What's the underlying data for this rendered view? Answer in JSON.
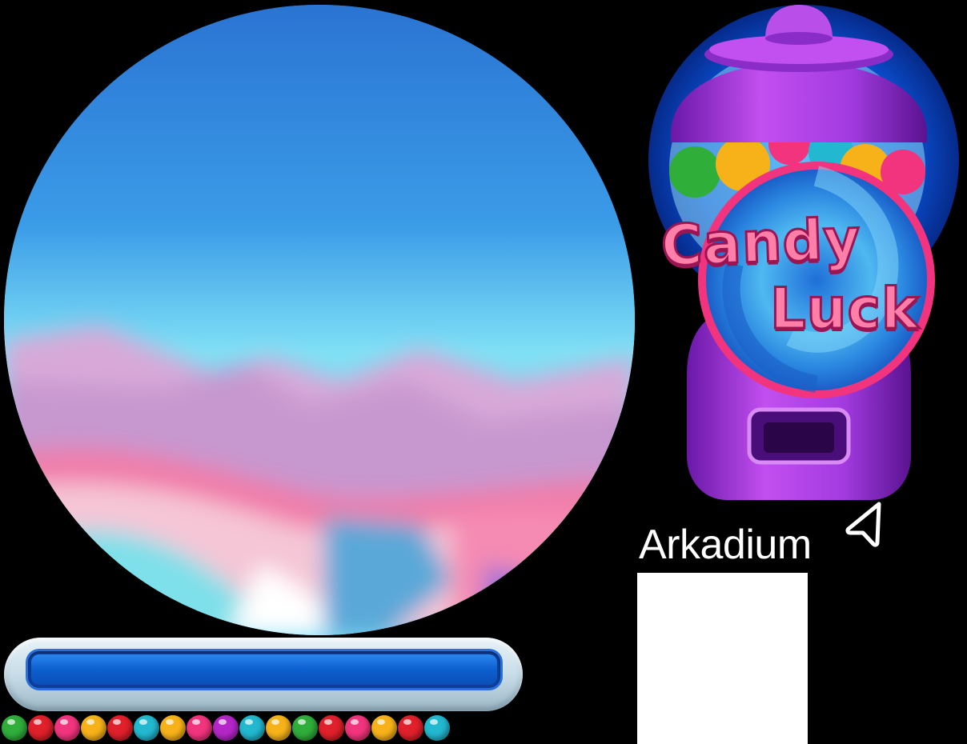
{
  "scene": {
    "icon": "candy-landscape-scene"
  },
  "progress": {
    "value": 1.0,
    "fill_color": "#0d5fcf"
  },
  "gumballs": [
    {
      "color": "#2fae3a"
    },
    {
      "color": "#e0202a"
    },
    {
      "color": "#f2347e"
    },
    {
      "color": "#f7b21a"
    },
    {
      "color": "#e0202a"
    },
    {
      "color": "#22b8cf"
    },
    {
      "color": "#f7b21a"
    },
    {
      "color": "#f2347e"
    },
    {
      "color": "#b526c9"
    },
    {
      "color": "#22b8cf"
    },
    {
      "color": "#f7b21a"
    },
    {
      "color": "#2fae3a"
    },
    {
      "color": "#e0202a"
    },
    {
      "color": "#f2347e"
    },
    {
      "color": "#f7b21a"
    },
    {
      "color": "#e0202a"
    },
    {
      "color": "#22b8cf"
    }
  ],
  "logo": {
    "line1": "Candy",
    "line2": "Luck",
    "text_color": "#ff7fa8",
    "machine_color": "#a23be0"
  },
  "brand": {
    "name": "Arkadium"
  }
}
